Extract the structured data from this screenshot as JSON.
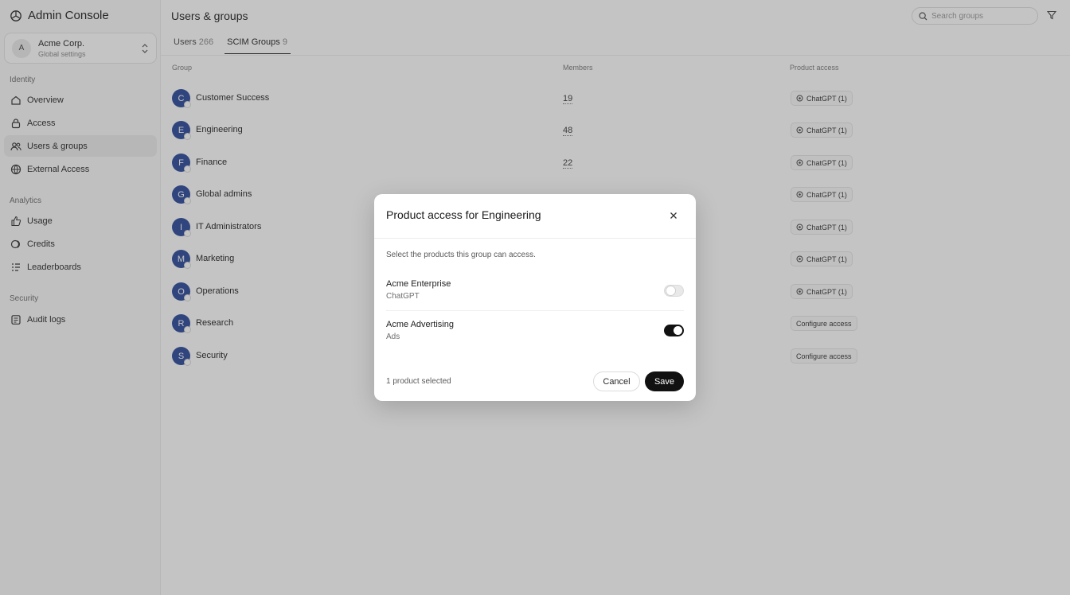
{
  "app": {
    "title": "Admin Console"
  },
  "org": {
    "initial": "A",
    "name": "Acme Corp.",
    "subtitle": "Global settings"
  },
  "sidebar": {
    "sections": [
      {
        "label": "Identity",
        "items": [
          {
            "label": "Overview",
            "icon": "home-icon"
          },
          {
            "label": "Access",
            "icon": "lock-icon"
          },
          {
            "label": "Users & groups",
            "icon": "users-icon",
            "active": true
          },
          {
            "label": "External Access",
            "icon": "globe-icon"
          }
        ]
      },
      {
        "label": "Analytics",
        "items": [
          {
            "label": "Usage",
            "icon": "thumbs-up-icon"
          },
          {
            "label": "Credits",
            "icon": "coins-icon"
          },
          {
            "label": "Leaderboards",
            "icon": "list-icon"
          }
        ]
      },
      {
        "label": "Security",
        "items": [
          {
            "label": "Audit logs",
            "icon": "log-icon"
          }
        ]
      }
    ]
  },
  "header": {
    "title": "Users & groups",
    "search_placeholder": "Search groups",
    "tabs": [
      {
        "label": "Users",
        "count": "266",
        "active": false
      },
      {
        "label": "SCIM Groups",
        "count": "9",
        "active": true
      }
    ]
  },
  "table": {
    "columns": [
      "Group",
      "Members",
      "Product access"
    ],
    "rows": [
      {
        "initial": "C",
        "name": "Customer Success",
        "members": "19",
        "access": "ChatGPT (1)"
      },
      {
        "initial": "E",
        "name": "Engineering",
        "members": "48",
        "access": "ChatGPT (1)"
      },
      {
        "initial": "F",
        "name": "Finance",
        "members": "22",
        "access": "ChatGPT (1)"
      },
      {
        "initial": "G",
        "name": "Global admins",
        "members": "",
        "access": "ChatGPT (1)"
      },
      {
        "initial": "I",
        "name": "IT Administrators",
        "members": "",
        "access": "ChatGPT (1)"
      },
      {
        "initial": "M",
        "name": "Marketing",
        "members": "",
        "access": "ChatGPT (1)"
      },
      {
        "initial": "O",
        "name": "Operations",
        "members": "",
        "access": "ChatGPT (1)"
      },
      {
        "initial": "R",
        "name": "Research",
        "members": "",
        "access": "Configure access"
      },
      {
        "initial": "S",
        "name": "Security",
        "members": "",
        "access": "Configure access"
      }
    ]
  },
  "modal": {
    "title": "Product access for Engineering",
    "description": "Select the products this group can access.",
    "products": [
      {
        "name": "Acme Enterprise",
        "subtitle": "ChatGPT",
        "enabled": false
      },
      {
        "name": "Acme Advertising",
        "subtitle": "Ads",
        "enabled": true
      }
    ],
    "footer_text": "1 product selected",
    "cancel_label": "Cancel",
    "save_label": "Save"
  },
  "colors": {
    "avatar": "#2b4a9b",
    "primary_button": "#111111",
    "overlay": "#3c3c3c"
  }
}
